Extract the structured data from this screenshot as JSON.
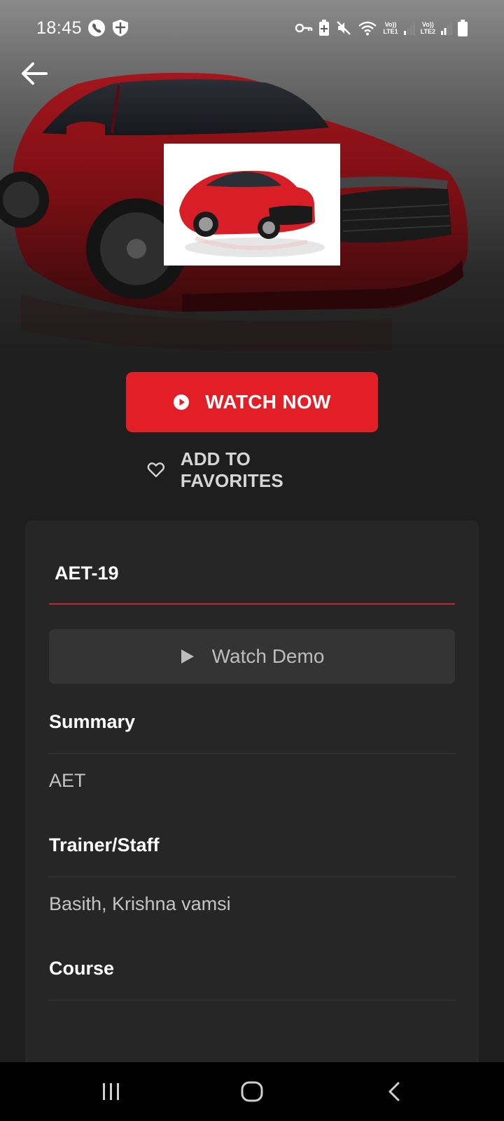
{
  "status_bar": {
    "time": "18:45",
    "net1_label_top": "Vo))",
    "net1_label_bottom": "LTE1",
    "net2_label_top": "Vo))",
    "net2_label_bottom": "LTE2",
    "icons": [
      "phone-icon",
      "shield-icon",
      "vpn-key-icon",
      "battery-saver-icon",
      "mute-icon",
      "wifi-icon",
      "signal-icon",
      "battery-icon"
    ]
  },
  "hero": {
    "back_icon": "arrow-left-icon"
  },
  "actions": {
    "watch_now_label": "WATCH NOW",
    "favorites_label": "ADD TO FAVORITES",
    "accent": "#e21f26"
  },
  "card": {
    "title": "AET-19",
    "watch_demo_label": "Watch Demo",
    "sections": [
      {
        "heading": "Summary",
        "value": "AET"
      },
      {
        "heading": "Trainer/Staff",
        "value": "Basith, Krishna vamsi"
      },
      {
        "heading": "Course",
        "value": ""
      }
    ]
  },
  "nav": {
    "icons": [
      "recents-icon",
      "home-icon",
      "back-icon"
    ]
  }
}
